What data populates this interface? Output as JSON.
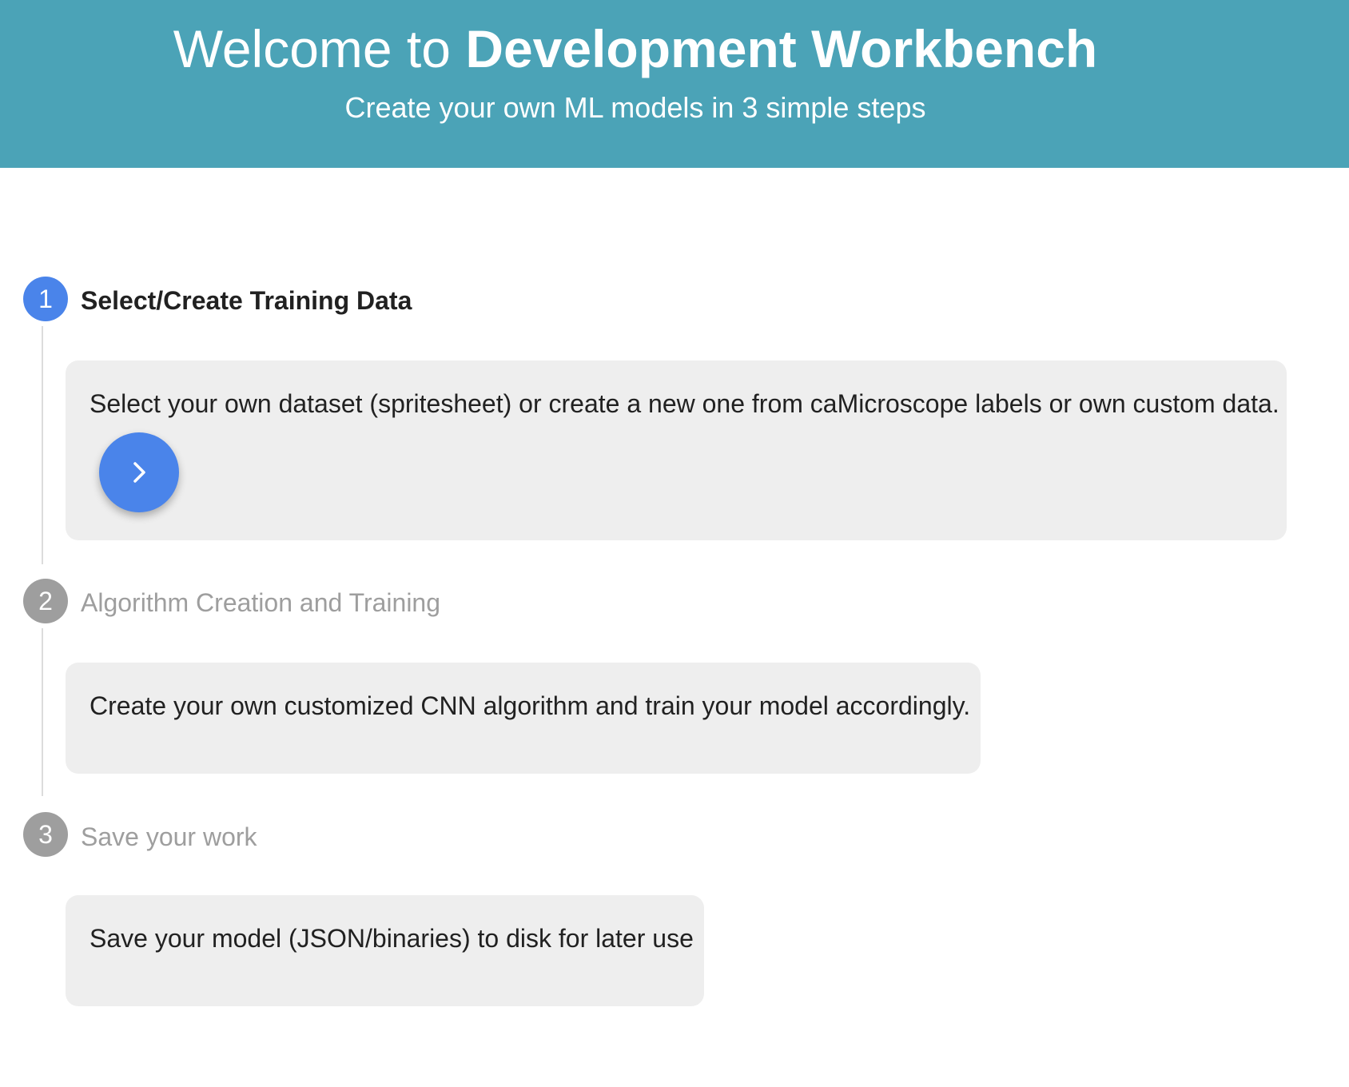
{
  "header": {
    "title_prefix": "Welcome to ",
    "title_strong": "Development Workbench",
    "subtitle": "Create your own ML models in 3 simple steps",
    "background_color": "#4ba3b7"
  },
  "steps": [
    {
      "number": "1",
      "title": "Select/Create Training Data",
      "state": "active",
      "description": "Select your own dataset (spritesheet) or create a new one from caMicroscope labels or own custom data.",
      "action_icon": "chevron-right-icon"
    },
    {
      "number": "2",
      "title": "Algorithm Creation and Training",
      "state": "inactive",
      "description": "Create your own customized CNN algorithm and train your model accordingly."
    },
    {
      "number": "3",
      "title": "Save your work",
      "state": "inactive",
      "description": "Save your model (JSON/binaries) to disk for later use"
    }
  ],
  "colors": {
    "active_step": "#4a84ea",
    "inactive_step": "#9e9e9e",
    "card_background": "#eeeeee"
  }
}
